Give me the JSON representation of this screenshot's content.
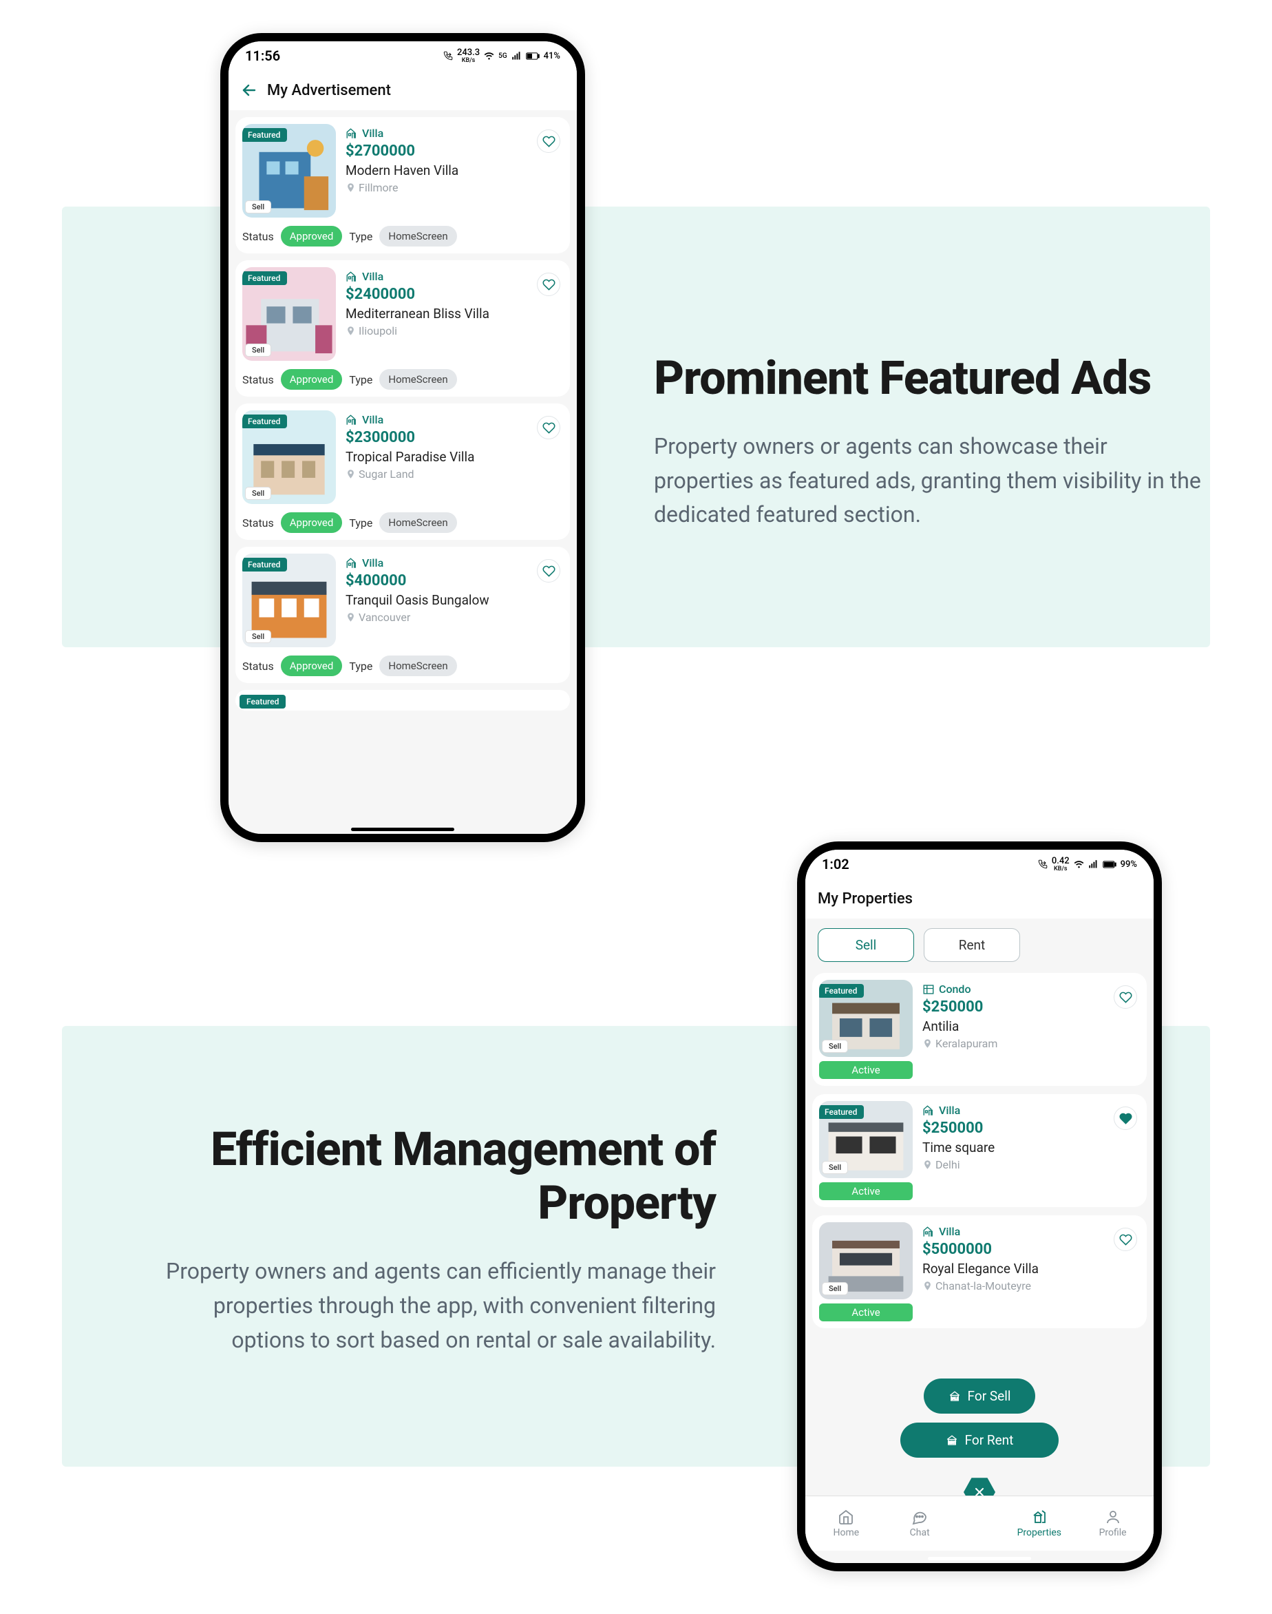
{
  "section1": {
    "title": "Prominent Featured Ads",
    "desc": "Property owners or agents can showcase their properties as featured ads, granting them visibility in the dedicated featured section."
  },
  "section2": {
    "title": "Efficient Management of Property",
    "desc": "Property owners and agents can efficiently manage their properties through the app, with convenient filtering options to sort based on rental or sale availability."
  },
  "phone1": {
    "status": {
      "time": "11:56",
      "net": "243.3",
      "netunit": "KB/s",
      "battery": "41%"
    },
    "header_title": "My Advertisement",
    "labels": {
      "status": "Status",
      "type": "Type",
      "status_pill": "Approved",
      "type_pill": "HomeScreen",
      "featured": "Featured",
      "sell": "Sell"
    },
    "cards": [
      {
        "type": "Villa",
        "price": "$2700000",
        "name": "Modern Haven Villa",
        "loc": "Fillmore"
      },
      {
        "type": "Villa",
        "price": "$2400000",
        "name": "Mediterranean Bliss Villa",
        "loc": "Ilioupoli"
      },
      {
        "type": "Villa",
        "price": "$2300000",
        "name": "Tropical Paradise Villa",
        "loc": "Sugar Land"
      },
      {
        "type": "Villa",
        "price": "$400000",
        "name": "Tranquil Oasis Bungalow",
        "loc": "Vancouver"
      }
    ]
  },
  "phone2": {
    "status": {
      "time": "1:02",
      "net": "0.42",
      "netunit": "KB/s",
      "battery": "99%"
    },
    "header_title": "My Properties",
    "tabs": {
      "sell": "Sell",
      "rent": "Rent"
    },
    "labels": {
      "featured": "Featured",
      "sell": "Sell",
      "active": "Active"
    },
    "cards": [
      {
        "type": "Condo",
        "price": "$250000",
        "name": "Antilia",
        "loc": "Keralapuram",
        "featured": true,
        "fav": false
      },
      {
        "type": "Villa",
        "price": "$250000",
        "name": "Time square",
        "loc": "Delhi",
        "featured": true,
        "fav": true
      },
      {
        "type": "Villa",
        "price": "$5000000",
        "name": "Royal Elegance Villa",
        "loc": "Chanat-la-Mouteyre",
        "featured": false,
        "fav": false
      }
    ],
    "fab": {
      "sell": "For Sell",
      "rent": "For Rent"
    },
    "nav": {
      "home": "Home",
      "chat": "Chat",
      "properties": "Properties",
      "profile": "Profile"
    }
  }
}
